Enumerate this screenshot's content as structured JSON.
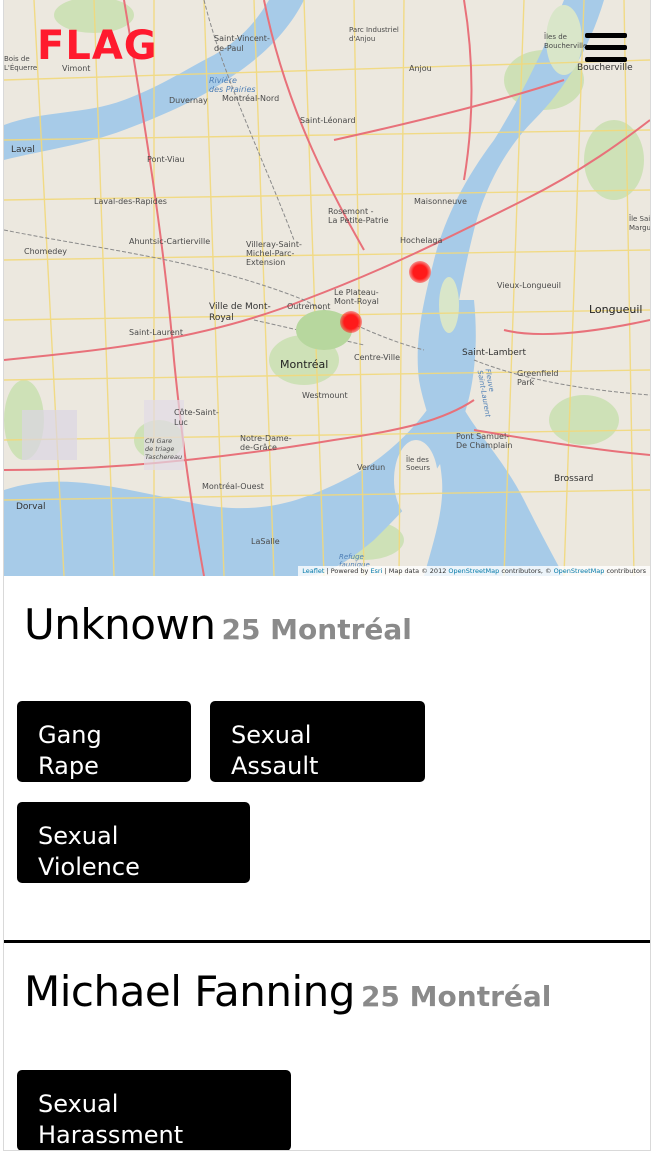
{
  "app": {
    "logo": "FLAG"
  },
  "map": {
    "labels": {
      "saint_vincent": "Saint-Vincent-\nde-Paul",
      "pont_viau": "Pont-Viau",
      "laval": "Laval",
      "vimont": "Vimont",
      "duvernay": "Duvernay",
      "montreal_nord": "Montréal-Nord",
      "riviere": "Rivière\ndes Prairies",
      "saint_leonard": "Saint-Léonard",
      "anjou": "Anjou",
      "parc_industriel": "Parc Industriel\nd'Anjou",
      "boucherville": "Boucherville",
      "iles": "Îles de\nBoucherville",
      "laval_rapides": "Laval-des-Rapides",
      "chomedey": "Chomedey",
      "ahuntsic": "Ahuntsic-Cartierville",
      "villeray": "Villeray-Saint-\nMichel-Parc-\nExtension",
      "rosemont": "Rosemont -\nLa Petite-Patrie",
      "maisonneuve": "Maisonneuve",
      "hochelaga": "Hochelaga",
      "vieux_longueuil": "Vieux-Longueuil",
      "longueuil": "Longueuil",
      "ville_mont_royal": "Ville de Mont-\nRoyal",
      "outremont": "Outremont",
      "plateau": "Le Plateau-\nMont-Royal",
      "saint_laurent": "Saint-Laurent",
      "montreal": "Montréal",
      "centre_ville": "Centre-Ville",
      "saint_lambert": "Saint-Lambert",
      "greenfield": "Greenfield\nPark",
      "westmount": "Westmount",
      "cote_saint_luc": "Côte-Saint-\nLuc",
      "notre_dame": "Notre-Dame-\nde-Grâce",
      "pont_samuel": "Pont Samuel-\nDe Champlain",
      "brossard": "Brossard",
      "verdun": "Verdun",
      "ile_soeurs": "Île des\nSoeurs",
      "montreal_ouest": "Montréal-Ouest",
      "dorval": "Dorval",
      "lasalle": "LaSalle",
      "refuge": "Refuge\nfaunique",
      "bois_boisbriand": "Bois de\nL'Équerre",
      "triage": "CN Gare\nde triage\nTaschereau",
      "fleuve": "Fleuve\nSaint-Laurent",
      "ile_sainte": "Île Sainte-\nMarguerite"
    },
    "attribution": {
      "leaflet": "Leaflet",
      "powered": " | Powered by ",
      "esri": "Esri",
      "data": " | Map data © 2012 ",
      "osm": "OpenStreetMap",
      "contrib": " contributors, © ",
      "osm2": "OpenStreetMap",
      "contrib2": " contributors"
    }
  },
  "records": [
    {
      "name": "Unknown",
      "meta": "25 Montréal",
      "tags": [
        "Gang\nRape",
        "Sexual\nAssault",
        "Sexual\nViolence"
      ]
    },
    {
      "name": "Michael Fanning",
      "meta": "25 Montréal",
      "tags": [
        "Sexual\nHarassment"
      ]
    }
  ]
}
